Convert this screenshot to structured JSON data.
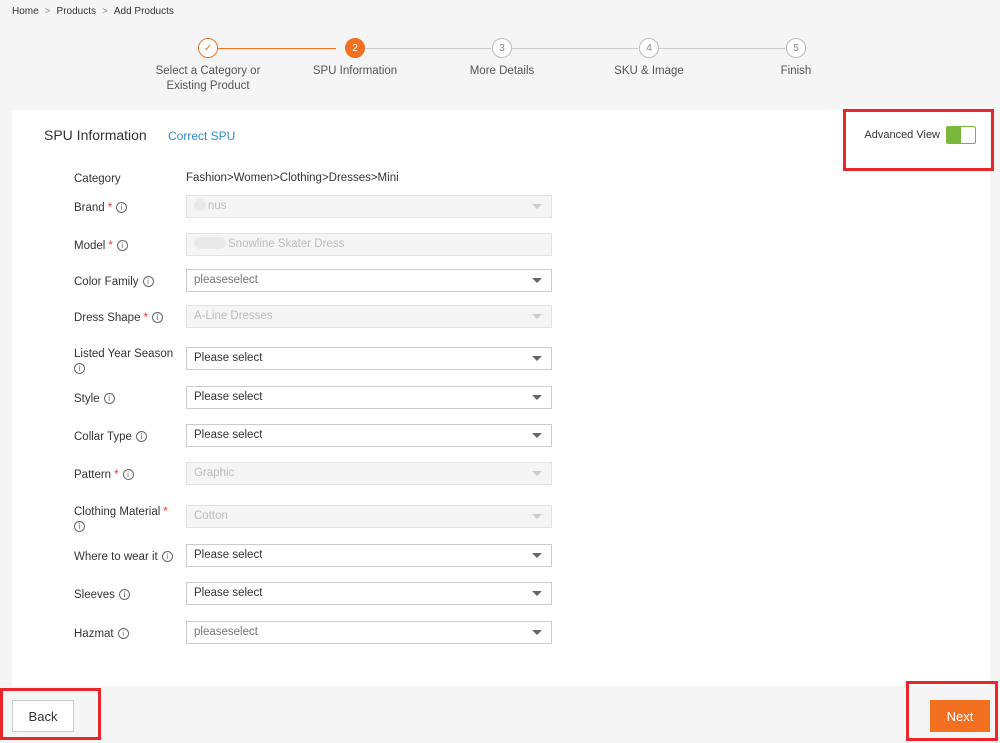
{
  "breadcrumb": {
    "home": "Home",
    "products": "Products",
    "current": "Add Products",
    "sep": ">"
  },
  "steps": [
    {
      "number": "✓",
      "label_line1": "Select a Category or",
      "label_line2": "Existing Product",
      "state": "done"
    },
    {
      "number": "2",
      "label_line1": "SPU Information",
      "label_line2": "",
      "state": "active"
    },
    {
      "number": "3",
      "label_line1": "More Details",
      "label_line2": "",
      "state": "pending"
    },
    {
      "number": "4",
      "label_line1": "SKU & Image",
      "label_line2": "",
      "state": "pending"
    },
    {
      "number": "5",
      "label_line1": "Finish",
      "label_line2": "",
      "state": "pending"
    }
  ],
  "panel": {
    "title": "SPU Information",
    "correct_spu": "Correct SPU",
    "advanced_view": "Advanced View",
    "advanced_view_on": true
  },
  "form": {
    "category": {
      "label": "Category",
      "value": "Fashion>Women>Clothing>Dresses>Mini"
    },
    "brand": {
      "label": "Brand",
      "value": "nus"
    },
    "model": {
      "label": "Model",
      "value": "Snowline Skater Dress"
    },
    "color_family": {
      "label": "Color Family",
      "value": "pleaseselect"
    },
    "dress_shape": {
      "label": "Dress Shape",
      "value": "A-Line Dresses"
    },
    "listed_year_season": {
      "label": "Listed Year Season",
      "value": "Please select"
    },
    "style": {
      "label": "Style",
      "value": "Please select"
    },
    "collar_type": {
      "label": "Collar Type",
      "value": "Please select"
    },
    "pattern": {
      "label": "Pattern",
      "value": "Graphic"
    },
    "clothing_material": {
      "label": "Clothing Material",
      "value": "Cotton"
    },
    "where_to_wear": {
      "label": "Where to wear it",
      "value": "Please select"
    },
    "sleeves": {
      "label": "Sleeves",
      "value": "Please select"
    },
    "hazmat": {
      "label": "Hazmat",
      "value": "pleaseselect"
    }
  },
  "required_mark": "*",
  "info_glyph": "i",
  "buttons": {
    "back": "Back",
    "next": "Next"
  },
  "colors": {
    "accent": "#f37021",
    "toggle": "#78b83a",
    "link": "#2a8fc9",
    "highlight": "#e8262b",
    "required": "#e4393c"
  }
}
